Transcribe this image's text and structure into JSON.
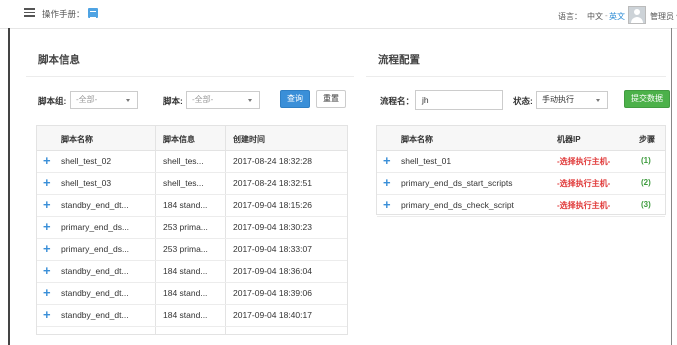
{
  "header": {
    "manual_label": "操作手册：",
    "manual_icon": "book-icon",
    "language_label": "语言：",
    "language_zh": "中文",
    "language_sep": "-",
    "language_en": "英文",
    "admin_label": "管理员 ▾"
  },
  "script_info": {
    "title": "脚本信息",
    "filters": {
      "group_label": "脚本组:",
      "group_value": "-全部-",
      "script_label": "脚本:",
      "script_value": "-全部-",
      "query_button": "查询",
      "reset_button": "重置"
    },
    "table": {
      "columns": [
        "脚本名称",
        "脚本信息",
        "创建时间"
      ],
      "rows": [
        {
          "name": "shell_test_02",
          "info": "shell_tes...",
          "time": "2017-08-24 18:32:28"
        },
        {
          "name": "shell_test_03",
          "info": "shell_tes...",
          "time": "2017-08-24 18:32:51"
        },
        {
          "name": "standby_end_dt...",
          "info": "184 stand...",
          "time": "2017-09-04 18:15:26"
        },
        {
          "name": "primary_end_ds...",
          "info": "253 prima...",
          "time": "2017-09-04 18:30:23"
        },
        {
          "name": "primary_end_ds...",
          "info": "253 prima...",
          "time": "2017-09-04 18:33:07"
        },
        {
          "name": "standby_end_dt...",
          "info": "184 stand...",
          "time": "2017-09-04 18:36:04"
        },
        {
          "name": "standby_end_dt...",
          "info": "184 stand...",
          "time": "2017-09-04 18:39:06"
        },
        {
          "name": "standby_end_dt...",
          "info": "184 stand...",
          "time": "2017-09-04 18:40:17"
        }
      ]
    }
  },
  "flow_config": {
    "title": "流程配置",
    "filters": {
      "flow_name_label": "流程名：",
      "flow_name_value": "jh",
      "status_label": "状态:",
      "status_value": "手动执行",
      "submit_button": "提交数据"
    },
    "table": {
      "columns": [
        "脚本名称",
        "机器IP",
        "步骤"
      ],
      "rows": [
        {
          "name": "shell_test_01",
          "ip": "-选择执行主机-",
          "step": "(1)"
        },
        {
          "name": "primary_end_ds_start_scripts",
          "ip": "-选择执行主机-",
          "step": "(2)"
        },
        {
          "name": "primary_end_ds_check_script",
          "ip": "-选择执行主机-",
          "step": "(3)"
        }
      ]
    }
  },
  "colors": {
    "primary": "#3a8fd8",
    "success": "#4cb14a",
    "danger": "#e03a3a",
    "step_green": "#3d9b3d"
  }
}
